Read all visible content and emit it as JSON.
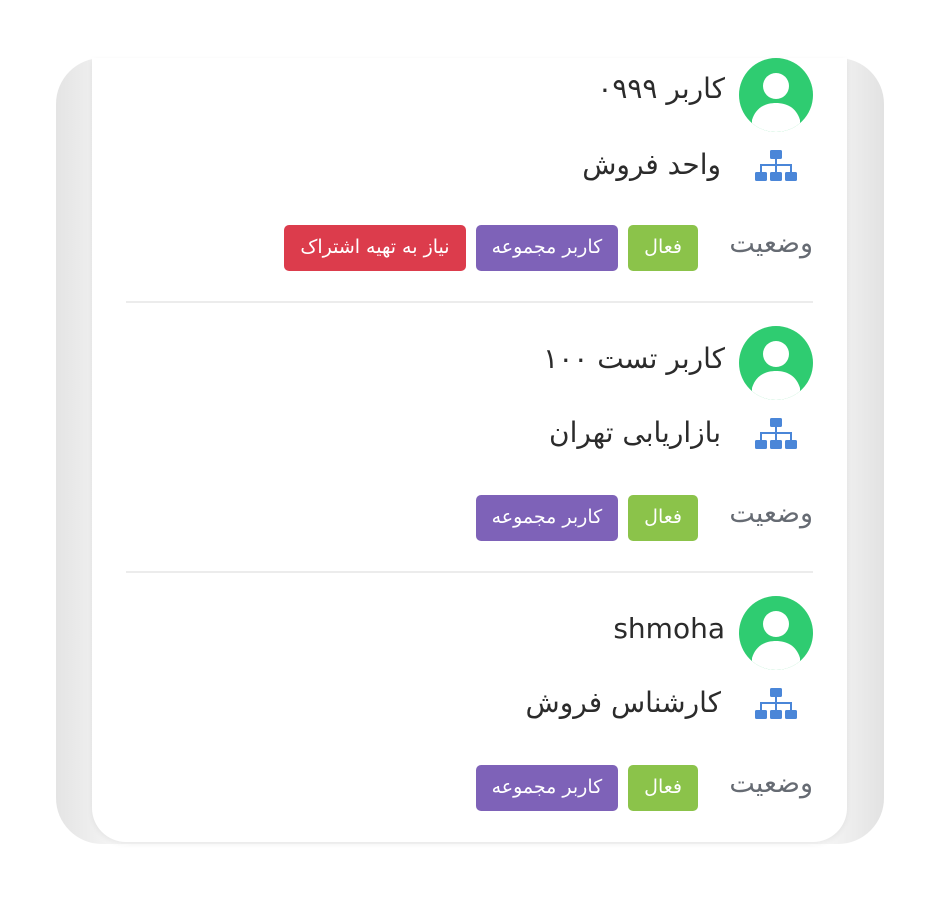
{
  "users": [
    {
      "name": "کاربر ۰۹۹۹",
      "unit": "واحد فروش",
      "status_label": "وضعیت",
      "badges": [
        "فعال",
        "کاربر مجموعه",
        "نیاز به تهیه اشتراک"
      ]
    },
    {
      "name": "کاربر تست ۱۰۰",
      "unit": "بازاریابی تهران",
      "status_label": "وضعیت",
      "badges": [
        "فعال",
        "کاربر مجموعه"
      ]
    },
    {
      "name": "shmoha",
      "unit": "کارشناس فروش",
      "status_label": "وضعیت",
      "badges": [
        "فعال",
        "کاربر مجموعه"
      ]
    }
  ],
  "colors": {
    "avatar": "#2fcc71",
    "unit_icon": "#4a86d8",
    "badge_active": "#8bc34a",
    "badge_group": "#7e62b8",
    "badge_subscription": "#dc3c4c"
  },
  "icons": {
    "avatar": "user-avatar-icon",
    "unit": "org-chart-icon"
  }
}
